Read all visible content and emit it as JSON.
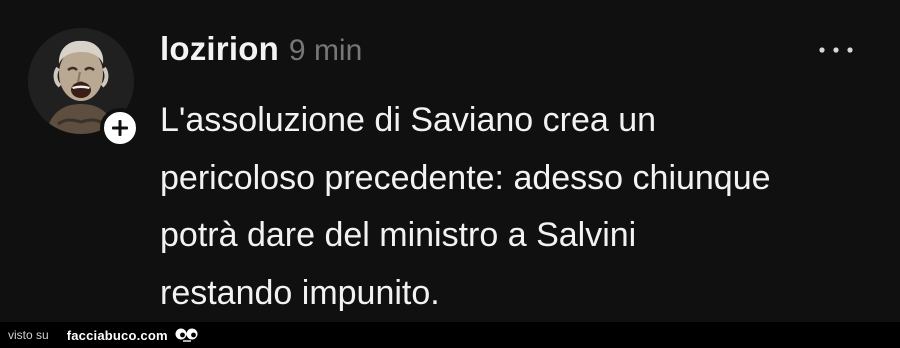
{
  "post": {
    "username": "lozirion",
    "timestamp": "9 min",
    "text_lines": [
      "L'assoluzione di Saviano crea un",
      "pericoloso precedente: adesso chiunque",
      "potrà dare del ministro a Salvini",
      "restando impunito."
    ],
    "avatar_icon": "avatar-laughing-man",
    "follow_icon": "plus-icon",
    "more_icon": "ellipsis-icon"
  },
  "footer": {
    "visto_label": "visto su",
    "brand": "facciabuco.com",
    "brand_icon": "eyes-icon"
  },
  "colors": {
    "background": "#101010",
    "text": "#f2f2f2",
    "muted": "#777777",
    "footer_bg": "#000000"
  }
}
